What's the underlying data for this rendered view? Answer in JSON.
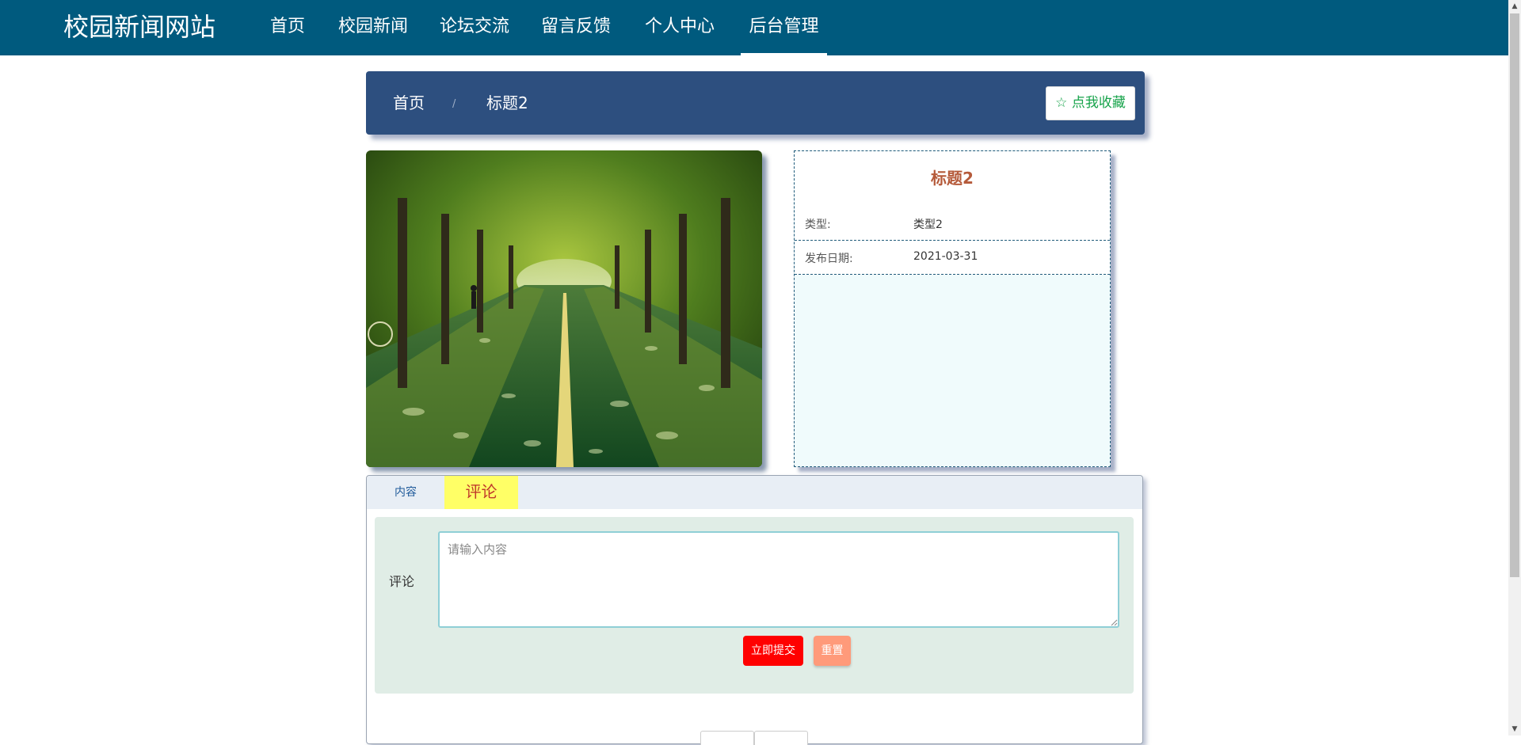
{
  "site": {
    "title": "校园新闻网站"
  },
  "nav": {
    "items": [
      {
        "label": "首页"
      },
      {
        "label": "校园新闻"
      },
      {
        "label": "论坛交流"
      },
      {
        "label": "留言反馈"
      },
      {
        "label": "个人中心"
      },
      {
        "label": "后台管理",
        "active": true
      }
    ]
  },
  "breadcrumb": {
    "home": "首页",
    "separator": "/",
    "current": "标题2"
  },
  "favorite_button": {
    "label": "☆ 点我收藏"
  },
  "article": {
    "title": "标题2",
    "image_icon": "tree-lined-road-photo",
    "fields": [
      {
        "label": "类型:",
        "value": "类型2"
      },
      {
        "label": "发布日期:",
        "value": "2021-03-31"
      }
    ]
  },
  "tabs": {
    "content_label": "内容",
    "comment_label": "评论"
  },
  "comment_form": {
    "label": "评论",
    "placeholder": "请输入内容",
    "submit_label": "立即提交",
    "reset_label": "重置"
  },
  "colors": {
    "nav_bg": "#005a7e",
    "breadcrumb_bg": "#2d4f7f",
    "title_color": "#b55a3a",
    "submit_bg": "#ff0000",
    "reset_bg": "#ff9a7a",
    "favorite_text": "#16a34a",
    "comment_tab_bg": "#ffff66"
  }
}
